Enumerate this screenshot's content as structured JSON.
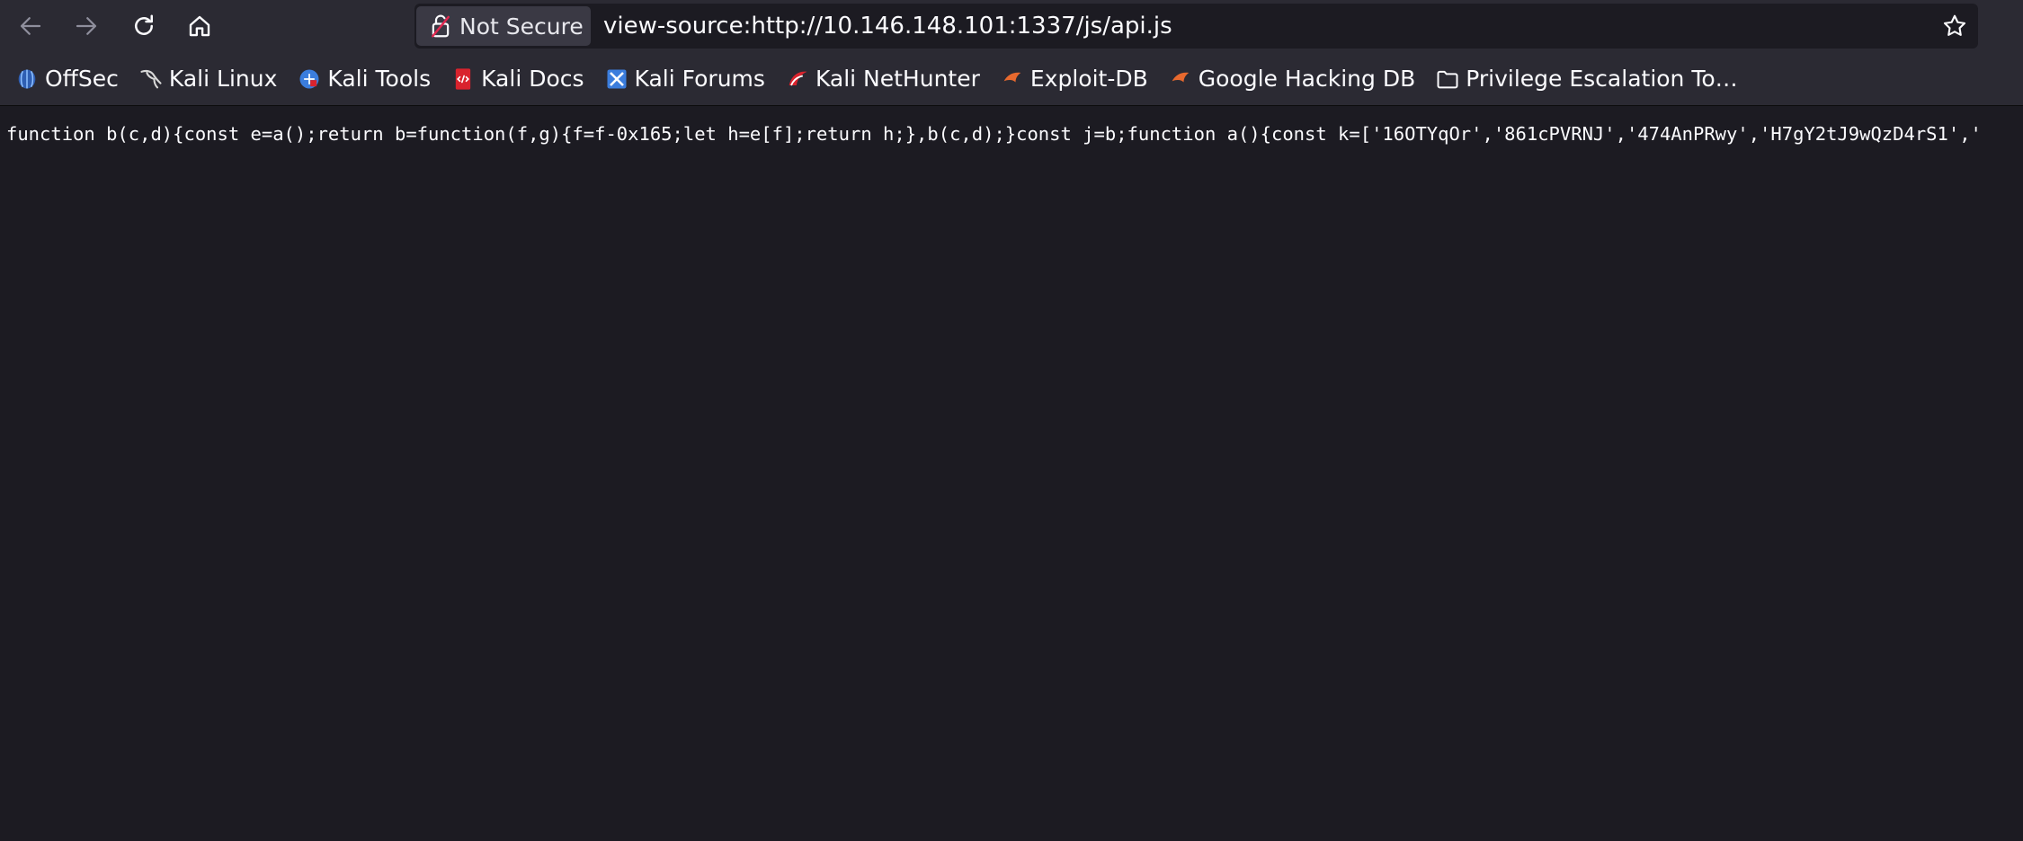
{
  "browser": {
    "identity_label": "Not Secure",
    "url": "view-source:http://10.146.148.101:1337/js/api.js",
    "icons": {
      "back": "arrow-left-icon",
      "forward": "arrow-right-icon",
      "reload": "reload-icon",
      "home": "home-icon",
      "identity": "broken-lock-icon",
      "bookmark_star": "star-icon"
    }
  },
  "bookmarks": [
    {
      "label": "OffSec",
      "icon": "offsec-icon",
      "color": "#3f7bd6"
    },
    {
      "label": "Kali Linux",
      "icon": "kali-dragon-icon",
      "color": "#d0d0d0"
    },
    {
      "label": "Kali Tools",
      "icon": "kali-tools-icon",
      "color": "#3b7ddd"
    },
    {
      "label": "Kali Docs",
      "icon": "kali-docs-icon",
      "color": "#d9232d"
    },
    {
      "label": "Kali Forums",
      "icon": "kali-forums-icon",
      "color": "#3b7ddd"
    },
    {
      "label": "Kali NetHunter",
      "icon": "kali-nethunter-icon",
      "color": "#d9232d"
    },
    {
      "label": "Exploit-DB",
      "icon": "exploit-db-icon",
      "color": "#e8692e"
    },
    {
      "label": "Google Hacking DB",
      "icon": "ghdb-icon",
      "color": "#e8692e"
    },
    {
      "label": "Privilege Escalation To…",
      "icon": "folder-icon",
      "color": "#fbfbfe"
    }
  ],
  "source": {
    "line1": "function b(c,d){const e=a();return b=function(f,g){f=f-0x165;let h=e[f];return h;},b(c,d);}const j=b;function a(){const k=['16OTYqOr','861cPVRNJ','474AnPRwy','H7gY2tJ9wQzD4rS1','"
  },
  "colors": {
    "toolbar_bg": "#2b2a33",
    "page_bg": "#1c1b22",
    "text": "#fbfbfe"
  }
}
